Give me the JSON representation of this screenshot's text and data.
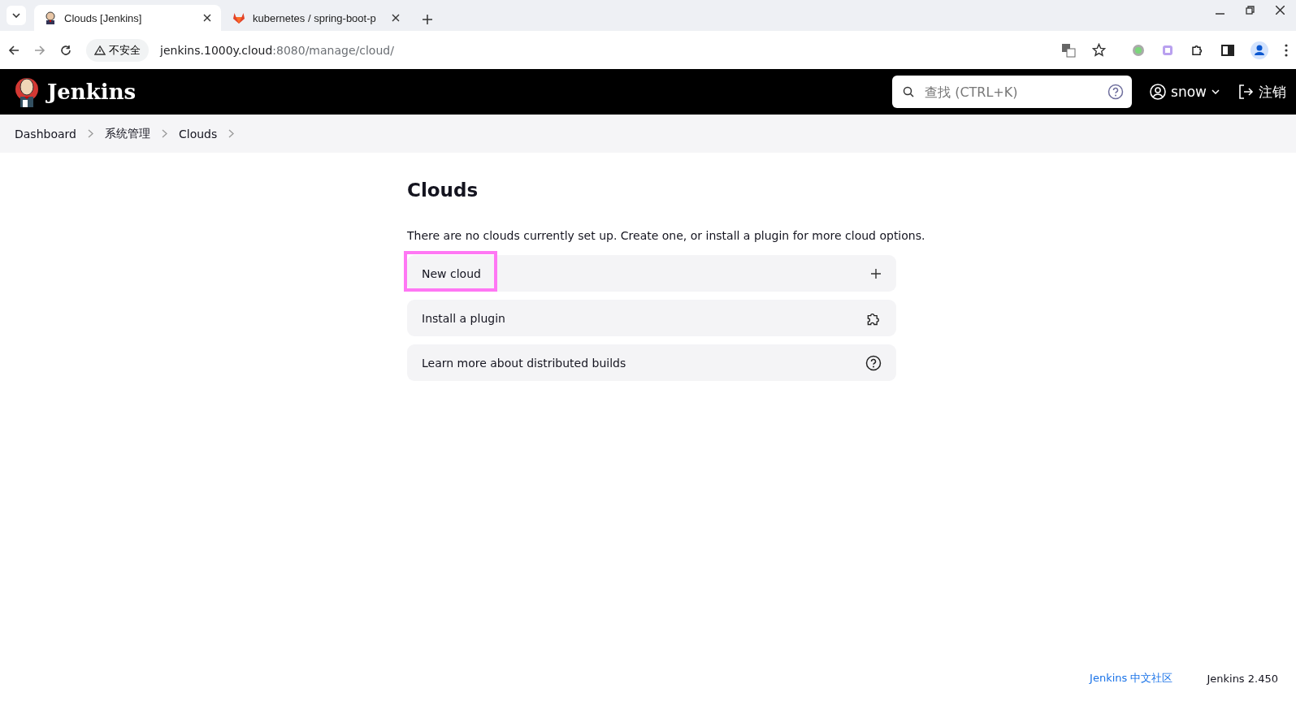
{
  "browser": {
    "tabs": [
      {
        "title": "Clouds [Jenkins]",
        "selected": true,
        "kind": "jenkins"
      },
      {
        "title": "kubernetes / spring-boot-p",
        "selected": false,
        "kind": "gitlab"
      }
    ],
    "security_label": "不安全",
    "url_host": "jenkins.1000y.cloud",
    "url_path": ":8080/manage/cloud/"
  },
  "header": {
    "brand": "Jenkins",
    "search": {
      "placeholder": "查找 (CTRL+K)"
    },
    "user": "snow",
    "logout": "注销"
  },
  "breadcrumbs": [
    "Dashboard",
    "系统管理",
    "Clouds"
  ],
  "page": {
    "title": "Clouds",
    "message": "There are no clouds currently set up. Create one, or install a plugin for more cloud options.",
    "actions": [
      {
        "label": "New cloud",
        "kind": "add",
        "highlighted": true
      },
      {
        "label": "Install a plugin",
        "kind": "plugin",
        "highlighted": false
      },
      {
        "label": "Learn more about distributed builds",
        "kind": "help",
        "highlighted": false
      }
    ]
  },
  "footer": {
    "community_link": "Jenkins 中文社区",
    "version": "Jenkins 2.450"
  }
}
